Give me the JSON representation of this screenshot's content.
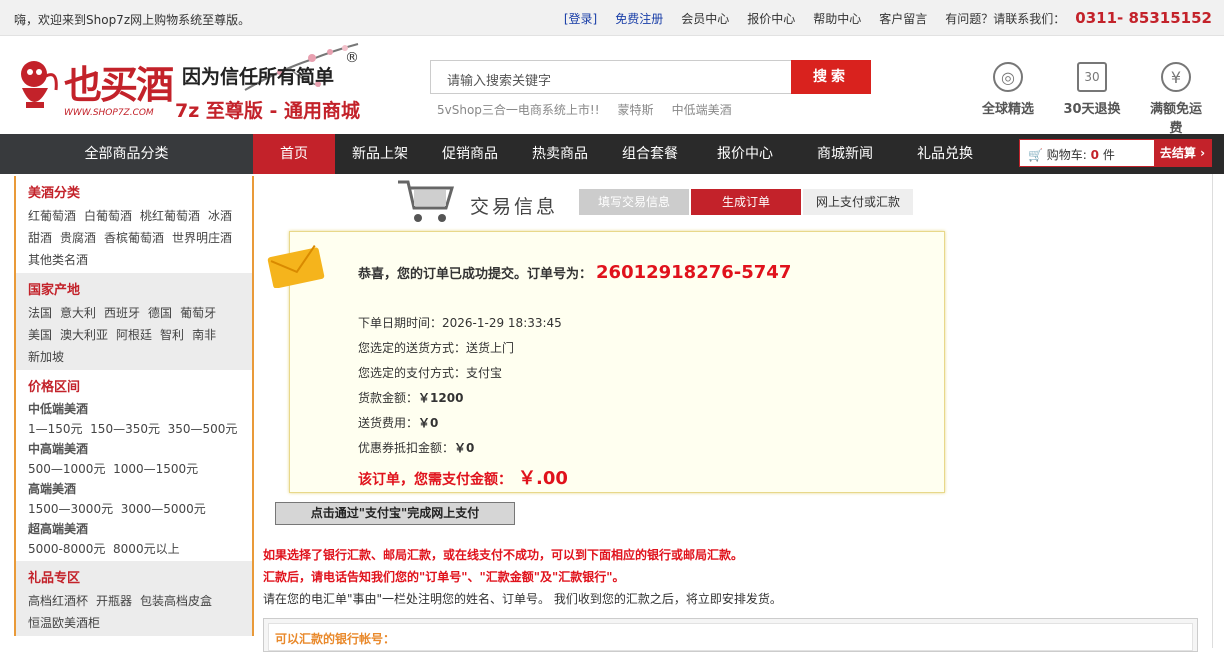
{
  "topbar": {
    "welcome": "嗨，欢迎来到Shop7z网上购物系统至尊版。",
    "login": "[登录]",
    "register": "免费注册",
    "member": "会员中心",
    "quote": "报价中心",
    "help": "帮助中心",
    "feedback": "客户留言",
    "phone_label": "有问题？请联系我们：",
    "phone": "0311- 85315152"
  },
  "header": {
    "brand": "也买酒",
    "url": "WWW.SHOP7Z.COM",
    "slogan": "因为信任所有简单",
    "slogan2": "7z 至尊版 - 通用商城",
    "registered": "®",
    "search_placeholder": "请输入搜索关键字",
    "search_button": "搜索",
    "hotwords": [
      "5vShop三合一电商系统上市!!",
      "蒙特斯",
      "中低端美酒"
    ],
    "services": [
      {
        "icon": "globe-icon",
        "label": "全球精选",
        "glyph": "◎"
      },
      {
        "icon": "calendar-icon",
        "label": "30天退换",
        "glyph": "30"
      },
      {
        "icon": "yen-icon",
        "label": "满额免运费",
        "glyph": "¥"
      }
    ]
  },
  "nav": {
    "category": "全部商品分类",
    "items": [
      "首页",
      "新品上架",
      "促销商品",
      "热卖商品",
      "组合套餐",
      "报价中心",
      "商城新闻",
      "礼品兑换"
    ],
    "cart_label": "购物车:",
    "cart_count": "0",
    "cart_unit": "件",
    "checkout": "去结算"
  },
  "sidebar": {
    "wine": {
      "title": "美酒分类",
      "rows": [
        [
          "红葡萄酒",
          "白葡萄酒",
          "桃红葡萄酒",
          "冰酒"
        ],
        [
          "甜酒",
          "贵腐酒",
          "香槟葡萄酒",
          "世界明庄酒"
        ],
        [
          "其他类名酒"
        ]
      ]
    },
    "country": {
      "title": "国家产地",
      "rows": [
        [
          "法国",
          "意大利",
          "西班牙",
          "德国",
          "葡萄牙"
        ],
        [
          "美国",
          "澳大利亚",
          "阿根廷",
          "智利",
          "南非"
        ],
        [
          "新加坡"
        ]
      ]
    },
    "price": {
      "title": "价格区间",
      "lines": [
        "中低端美酒",
        "1—150元  150—350元  350—500元",
        "中高端美酒",
        "500—1000元  1000—1500元",
        "高端美酒",
        "1500—3000元  3000—5000元",
        "超高端美酒",
        "5000-8000元  8000元以上"
      ]
    },
    "gift": {
      "title": "礼品专区",
      "rows": [
        [
          "高档红酒杯",
          "开瓶器",
          "包装高档皮盒"
        ],
        [
          "恒温欧美酒柜"
        ]
      ]
    }
  },
  "trade": {
    "title": "交易信息",
    "steps": [
      "填写交易信息",
      "生成订单",
      "网上支付或汇款"
    ]
  },
  "order": {
    "success": "恭喜，您的订单已成功提交。订单号为：",
    "order_id": "26012918276-5747",
    "date": "下单日期时间：2026-1-29 18:33:45",
    "delivery": "您选定的送货方式：送货上门",
    "payment": "您选定的支付方式：支付宝",
    "goods_label": "货款金额：",
    "goods_amount": "￥1200",
    "shipping_label": "送货费用：",
    "shipping_amount": "￥0",
    "coupon_label": "优惠券抵扣金额：",
    "coupon_amount": "￥0",
    "pay_label": "该订单，您需支付金额：",
    "pay_amount": "￥.00",
    "pay_button": "点击通过\"支付宝\"完成网上支付"
  },
  "notes": {
    "line1": "如果选择了银行汇款、邮局汇款，或在线支付不成功，可以到下面相应的银行或邮局汇款。",
    "line2": "汇款后，请电话告知我们您的\"订单号\"、\"汇款金额\"及\"汇款银行\"。",
    "line3": "请在您的电汇单\"事由\"一栏处注明您的姓名、订单号。 我们收到您的汇款之后，将立即安排发货。",
    "bank_title": "可以汇款的银行帐号："
  },
  "colors": {
    "accent": "#c3222a",
    "orange": "#e99a39",
    "nav": "#2a2a2a"
  }
}
